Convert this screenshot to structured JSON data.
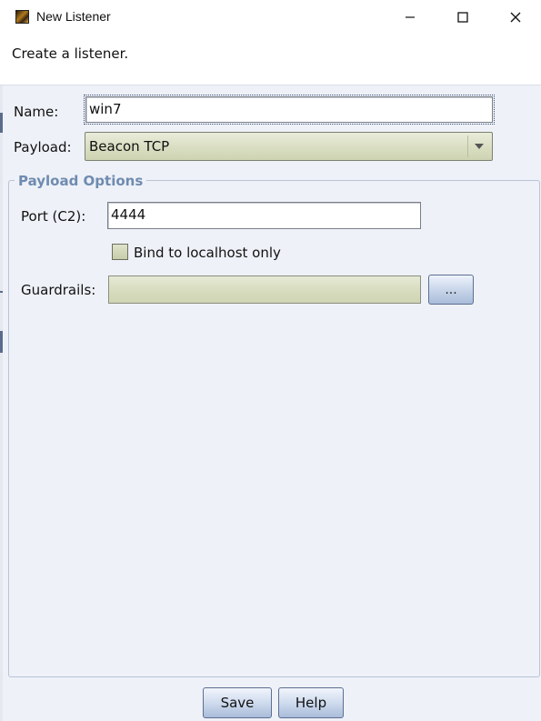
{
  "window": {
    "title": "New Listener",
    "controls": {
      "minimize": "minimize-icon",
      "maximize": "maximize-icon",
      "close": "close-icon"
    }
  },
  "header": {
    "description": "Create a listener."
  },
  "form": {
    "name_label": "Name:",
    "name_value": "win7",
    "payload_label": "Payload:",
    "payload_value": "Beacon TCP"
  },
  "payload_options": {
    "group_title": "Payload Options",
    "port_label": "Port (C2):",
    "port_value": "4444",
    "bind_localhost_label": "Bind to localhost only",
    "bind_localhost_checked": false,
    "guardrails_label": "Guardrails:",
    "guardrails_value": "",
    "guardrails_button": "..."
  },
  "buttons": {
    "save": "Save",
    "help": "Help"
  },
  "colors": {
    "background": "#eef1f7",
    "group_title": "#6f8bb0",
    "combo_fill": "#d9dec2",
    "button_fill": "#cfdbee"
  }
}
